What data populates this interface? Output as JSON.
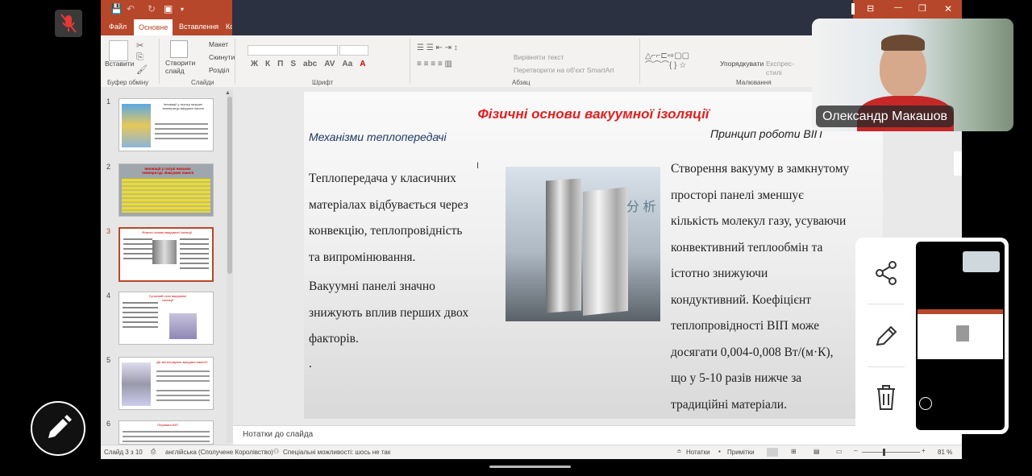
{
  "quick_access": {
    "save": "💾",
    "undo": "↶",
    "redo": "↻",
    "present": "▣"
  },
  "window_controls": {
    "ribbon_toggle": "⊟",
    "minimize": "—",
    "restore": "❐",
    "close": "✕"
  },
  "ribbon_tabs": [
    "Файл",
    "Основне",
    "Вставлення",
    "Ко"
  ],
  "ribbon": {
    "paste": "Вставити",
    "new_slide": "Створити слайд",
    "layout": "Макет",
    "reset": "Скинути",
    "sections": "Розділ",
    "font_buttons": [
      "Ж",
      "К",
      "П",
      "S",
      "abc",
      "AV",
      "Aa",
      "A"
    ],
    "text_direction": "Вирівняти текст",
    "convert_smartart": "Перетворити на об'єкт SmartArt",
    "arrange": "Упорядкувати",
    "quick_styles": "Експрес-стилі",
    "groups": [
      "Буфер обміну",
      "Слайди",
      "Шрифт",
      "Абзац",
      "Малювання"
    ]
  },
  "thumbnails": [
    {
      "num": "1",
      "caption": "Інновації у техніці низьких температур вакуумні панелі"
    },
    {
      "num": "2",
      "caption": "Інновації у галузі низьких температур. Вакуумні панелі"
    },
    {
      "num": "3",
      "caption": "Фізичні основи вакуумної ізоляції"
    },
    {
      "num": "4",
      "caption": "Сучасний стан вакуумної ізоляції"
    },
    {
      "num": "5",
      "caption": "Де застосовують вакуумні панелі?"
    },
    {
      "num": "6",
      "caption": "Переваги ВІП"
    }
  ],
  "slide": {
    "title": "Фізичні основи вакуумної ізоляції",
    "left_heading": "Механізми теплопередачі",
    "right_heading": "Принцип роботи ВІП",
    "left_lines": [
      "Теплопередача у класичних",
      "матеріалах відбувається через",
      "конвекцію, теплопровідність",
      "та випромінювання."
    ],
    "left_lines2": [
      "Вакуумні панелі значно",
      "знижують вплив перших двох",
      "факторів."
    ],
    "bullet_dot": ".",
    "right_lines": [
      "Створення вакууму в замкнутому",
      "просторі панелі зменшує",
      "кількість молекул газу, усуваючи",
      "конвективний теплообмін та",
      "істотно знижуючи",
      "кондуктивний. Коефіцієнт",
      "теплопровідності ВІП може",
      "досягати 0,004-0,008 Вт/(м·К),",
      "що у 5-10 разів нижче за",
      "традиційні матеріали."
    ],
    "image_text": "分 析"
  },
  "notes_placeholder": "Нотатки до слайда",
  "status": {
    "slide_counter": "Слайд 3 з 10",
    "language": "англійська (Сполучене Королівство)",
    "accessibility": "Спеціальні можливості: шось не так",
    "notes": "Нотатки",
    "comments": "Примітки",
    "zoom": "81 %"
  },
  "video": {
    "participant_name": "Олександр Макашов"
  },
  "colors": {
    "accent": "#b7472a",
    "title_red": "#e02020",
    "heading_blue": "#1f3864"
  }
}
